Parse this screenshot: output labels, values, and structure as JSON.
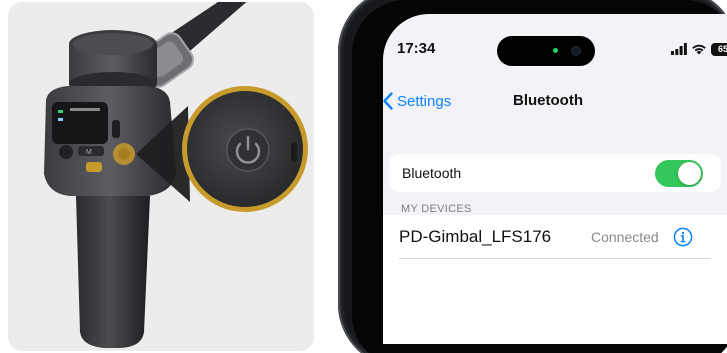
{
  "status_bar": {
    "time": "17:34",
    "battery": "65"
  },
  "nav": {
    "back_label": "Settings",
    "title": "Bluetooth"
  },
  "bluetooth_toggle": {
    "label": "Bluetooth",
    "on": true
  },
  "devices_section": {
    "header": "MY DEVICES",
    "items": [
      {
        "name": "PD-Gimbal_LFS176",
        "status": "Connected"
      }
    ]
  },
  "colors": {
    "accent": "#0a84ff",
    "toggle_on": "#34c759",
    "highlight_ring": "#c79a2c"
  },
  "icons": {
    "back": "chevron-left-icon",
    "info": "info-circle-icon",
    "power": "power-icon"
  }
}
